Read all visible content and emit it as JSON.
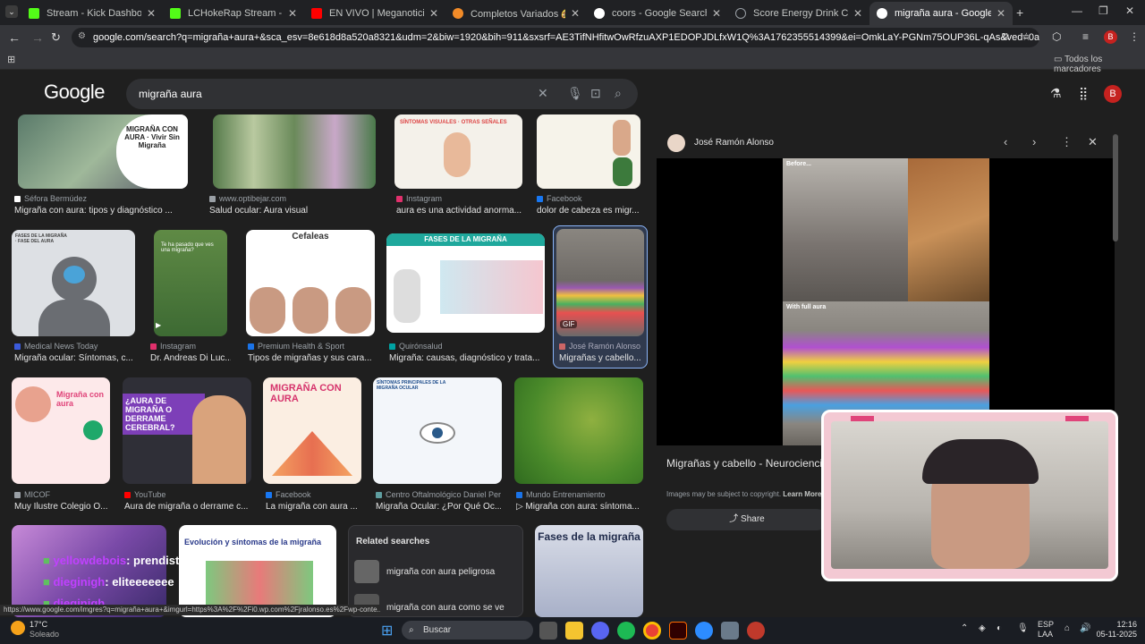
{
  "tabs": [
    {
      "label": "Stream - Kick Dashboard",
      "color": "#53fc18"
    },
    {
      "label": "LCHokeRap Stream - Watch Liv",
      "color": "#53fc18"
    },
    {
      "label": "EN VIVO | Meganoticias Ahora",
      "color": "#ff0000"
    },
    {
      "label": "Completos Variados 🌮🌮🌮",
      "color": "#f28b28"
    },
    {
      "label": "coors - Google Search",
      "color": "#ffffff"
    },
    {
      "label": "Score Energy Drink Chile | Bebi",
      "color": "#9aa0a6"
    },
    {
      "label": "migraña aura - Google Search",
      "color": "#ffffff"
    }
  ],
  "address": "google.com/search?q=migraña+aura+&sca_esv=8e618d8a520a8321&udm=2&biw=1920&bih=911&sxsrf=AE3TifNHfitwOwRfzuAXP1EDOPJDLfxW1Q%3A1762355514399&ei=OmkLaY-PGNm75OUP36L-qAs&ved=0ahUKEwiPIJ3zpduQAxXZHbk...",
  "bookmarks_label": "Todos los marcadores",
  "google": {
    "logo": "Google",
    "query": "migraña aura",
    "avatar": "B"
  },
  "row1": [
    {
      "source": "Séfora Bermúdez",
      "title": "Migraña con aura: tipos y diagnóstico ...",
      "color": "#ffffff",
      "thumb": "MIGRAÑA CON AURA · Vivir Sin Migraña"
    },
    {
      "source": "www.optibejar.com",
      "title": "Salud ocular: Aura visual",
      "color": "#9aa0a6",
      "thumb": ""
    },
    {
      "source": "Instagram",
      "title": "aura es una actividad anorma...",
      "color": "#e1306c",
      "thumb": "SÍNTOMAS VISUALES · OTRAS SEÑALES"
    },
    {
      "source": "Facebook",
      "title": "dolor de cabeza es migr...",
      "color": "#1877f2",
      "thumb": ""
    }
  ],
  "row2": [
    {
      "source": "Medical News Today",
      "title": "Migraña ocular: Síntomas, c...",
      "color": "#3b5bdb",
      "thumb": "FASES DE LA MIGRAÑA · FASE DEL AURA"
    },
    {
      "source": "Instagram",
      "title": "Dr. Andreas Di Luc...",
      "color": "#e1306c",
      "thumb": "Te ha pasado que ves una migraña?"
    },
    {
      "source": "Premium Health & Sport",
      "title": "Tipos de migrañas y sus cara...",
      "color": "#1a73e8",
      "thumb": "Cefaleas"
    },
    {
      "source": "Quirónsalud",
      "title": "Migraña: causas, diagnóstico y trata...",
      "color": "#00a3a3",
      "thumb": "FASES DE LA MIGRAÑA"
    },
    {
      "source": "José Ramón Alonso",
      "title": "Migrañas y cabello...",
      "color": "#c66",
      "thumb": "GIF"
    }
  ],
  "row3": [
    {
      "source": "MICOF",
      "title": "Muy Ilustre Colegio O...",
      "color": "#9aa0a6",
      "thumb": "Migraña con aura"
    },
    {
      "source": "YouTube",
      "title": "Aura de migraña o derrame c...",
      "color": "#ff0000",
      "thumb": "¿AURA DE MIGRAÑA O DERRAME CEREBRAL?"
    },
    {
      "source": "Facebook",
      "title": "La migraña con aura ...",
      "color": "#1877f2",
      "thumb": "MIGRAÑA CON AURA"
    },
    {
      "source": "Centro Oftalmológico Daniel Per...",
      "title": "Migraña Ocular: ¿Por Qué Oc...",
      "color": "#5f9ea0",
      "thumb": "SÍNTOMAS PRINCIPALES DE LA MIGRAÑA OCULAR"
    },
    {
      "source": "Mundo Entrenamiento",
      "title": "▷ Migraña con aura: síntoma...",
      "color": "#1a73e8",
      "thumb": ""
    }
  ],
  "row4": {
    "thumb2": "Evolución y síntomas de la migraña",
    "thumb4": "Fases de la migraña",
    "related_title": "Related searches",
    "related": [
      "migraña con aura peligrosa",
      "migraña con aura como se ve"
    ]
  },
  "chat": [
    {
      "user": "yellowdebois",
      "msg": ": prendiste oe"
    },
    {
      "user": "dieginigh",
      "msg": ": eliteeeeeee"
    },
    {
      "user": "dieginigh",
      "msg": ""
    }
  ],
  "statusbar_url": "https://www.google.com/imgres?q=migraña+aura+&imgurl=https%3A%2F%2Fi0.wp.com%2Fjralonso.es%2Fwp-conte...",
  "panel": {
    "author": "José Ramón Alonso",
    "image_before": "Before...",
    "image_after": "With full aura",
    "title": "Migrañas y cabello - Neurociencia, Autismo. Depresión. Respiración",
    "copyright": "Images may be subject to copyright.",
    "learn_more": "Learn More",
    "share": "Share"
  },
  "taskbar": {
    "weather_temp": "17°C",
    "weather_desc": "Soleado",
    "search": "Buscar",
    "lang": "ESP",
    "lang2": "LAA",
    "time": "12:16",
    "date": "05-11-2025"
  }
}
